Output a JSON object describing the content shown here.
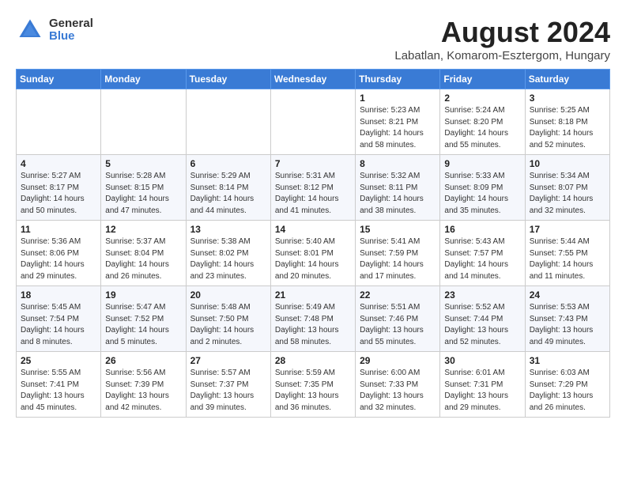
{
  "header": {
    "logo_general": "General",
    "logo_blue": "Blue",
    "month_title": "August 2024",
    "location": "Labatlan, Komarom-Esztergom, Hungary"
  },
  "days_of_week": [
    "Sunday",
    "Monday",
    "Tuesday",
    "Wednesday",
    "Thursday",
    "Friday",
    "Saturday"
  ],
  "weeks": [
    [
      {
        "day": "",
        "info": ""
      },
      {
        "day": "",
        "info": ""
      },
      {
        "day": "",
        "info": ""
      },
      {
        "day": "",
        "info": ""
      },
      {
        "day": "1",
        "info": "Sunrise: 5:23 AM\nSunset: 8:21 PM\nDaylight: 14 hours\nand 58 minutes."
      },
      {
        "day": "2",
        "info": "Sunrise: 5:24 AM\nSunset: 8:20 PM\nDaylight: 14 hours\nand 55 minutes."
      },
      {
        "day": "3",
        "info": "Sunrise: 5:25 AM\nSunset: 8:18 PM\nDaylight: 14 hours\nand 52 minutes."
      }
    ],
    [
      {
        "day": "4",
        "info": "Sunrise: 5:27 AM\nSunset: 8:17 PM\nDaylight: 14 hours\nand 50 minutes."
      },
      {
        "day": "5",
        "info": "Sunrise: 5:28 AM\nSunset: 8:15 PM\nDaylight: 14 hours\nand 47 minutes."
      },
      {
        "day": "6",
        "info": "Sunrise: 5:29 AM\nSunset: 8:14 PM\nDaylight: 14 hours\nand 44 minutes."
      },
      {
        "day": "7",
        "info": "Sunrise: 5:31 AM\nSunset: 8:12 PM\nDaylight: 14 hours\nand 41 minutes."
      },
      {
        "day": "8",
        "info": "Sunrise: 5:32 AM\nSunset: 8:11 PM\nDaylight: 14 hours\nand 38 minutes."
      },
      {
        "day": "9",
        "info": "Sunrise: 5:33 AM\nSunset: 8:09 PM\nDaylight: 14 hours\nand 35 minutes."
      },
      {
        "day": "10",
        "info": "Sunrise: 5:34 AM\nSunset: 8:07 PM\nDaylight: 14 hours\nand 32 minutes."
      }
    ],
    [
      {
        "day": "11",
        "info": "Sunrise: 5:36 AM\nSunset: 8:06 PM\nDaylight: 14 hours\nand 29 minutes."
      },
      {
        "day": "12",
        "info": "Sunrise: 5:37 AM\nSunset: 8:04 PM\nDaylight: 14 hours\nand 26 minutes."
      },
      {
        "day": "13",
        "info": "Sunrise: 5:38 AM\nSunset: 8:02 PM\nDaylight: 14 hours\nand 23 minutes."
      },
      {
        "day": "14",
        "info": "Sunrise: 5:40 AM\nSunset: 8:01 PM\nDaylight: 14 hours\nand 20 minutes."
      },
      {
        "day": "15",
        "info": "Sunrise: 5:41 AM\nSunset: 7:59 PM\nDaylight: 14 hours\nand 17 minutes."
      },
      {
        "day": "16",
        "info": "Sunrise: 5:43 AM\nSunset: 7:57 PM\nDaylight: 14 hours\nand 14 minutes."
      },
      {
        "day": "17",
        "info": "Sunrise: 5:44 AM\nSunset: 7:55 PM\nDaylight: 14 hours\nand 11 minutes."
      }
    ],
    [
      {
        "day": "18",
        "info": "Sunrise: 5:45 AM\nSunset: 7:54 PM\nDaylight: 14 hours\nand 8 minutes."
      },
      {
        "day": "19",
        "info": "Sunrise: 5:47 AM\nSunset: 7:52 PM\nDaylight: 14 hours\nand 5 minutes."
      },
      {
        "day": "20",
        "info": "Sunrise: 5:48 AM\nSunset: 7:50 PM\nDaylight: 14 hours\nand 2 minutes."
      },
      {
        "day": "21",
        "info": "Sunrise: 5:49 AM\nSunset: 7:48 PM\nDaylight: 13 hours\nand 58 minutes."
      },
      {
        "day": "22",
        "info": "Sunrise: 5:51 AM\nSunset: 7:46 PM\nDaylight: 13 hours\nand 55 minutes."
      },
      {
        "day": "23",
        "info": "Sunrise: 5:52 AM\nSunset: 7:44 PM\nDaylight: 13 hours\nand 52 minutes."
      },
      {
        "day": "24",
        "info": "Sunrise: 5:53 AM\nSunset: 7:43 PM\nDaylight: 13 hours\nand 49 minutes."
      }
    ],
    [
      {
        "day": "25",
        "info": "Sunrise: 5:55 AM\nSunset: 7:41 PM\nDaylight: 13 hours\nand 45 minutes."
      },
      {
        "day": "26",
        "info": "Sunrise: 5:56 AM\nSunset: 7:39 PM\nDaylight: 13 hours\nand 42 minutes."
      },
      {
        "day": "27",
        "info": "Sunrise: 5:57 AM\nSunset: 7:37 PM\nDaylight: 13 hours\nand 39 minutes."
      },
      {
        "day": "28",
        "info": "Sunrise: 5:59 AM\nSunset: 7:35 PM\nDaylight: 13 hours\nand 36 minutes."
      },
      {
        "day": "29",
        "info": "Sunrise: 6:00 AM\nSunset: 7:33 PM\nDaylight: 13 hours\nand 32 minutes."
      },
      {
        "day": "30",
        "info": "Sunrise: 6:01 AM\nSunset: 7:31 PM\nDaylight: 13 hours\nand 29 minutes."
      },
      {
        "day": "31",
        "info": "Sunrise: 6:03 AM\nSunset: 7:29 PM\nDaylight: 13 hours\nand 26 minutes."
      }
    ]
  ]
}
